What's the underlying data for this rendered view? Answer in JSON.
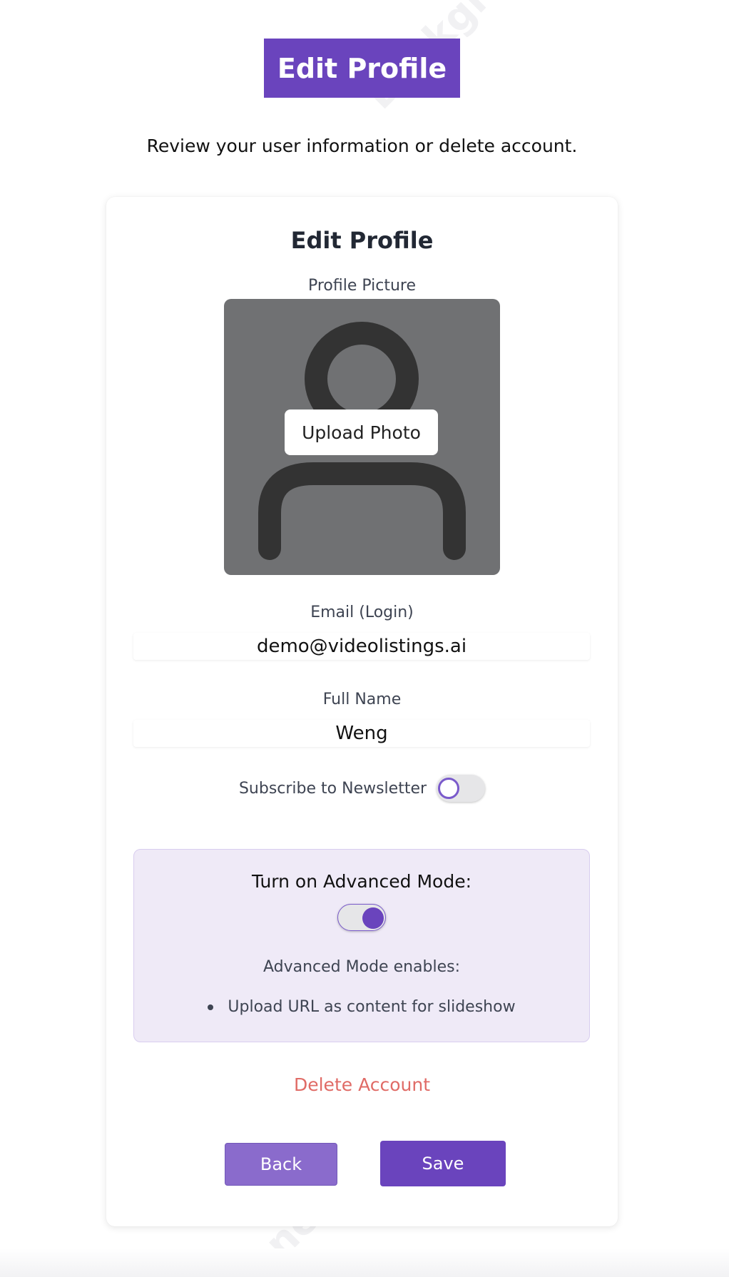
{
  "header": {
    "title": "Edit Profile",
    "subtitle": "Review your user information or delete account."
  },
  "card": {
    "title": "Edit Profile",
    "profile_picture_label": "Profile Picture",
    "upload_photo_label": "Upload Photo",
    "email_label": "Email (Login)",
    "email_value": "demo@videolistings.ai",
    "full_name_label": "Full Name",
    "full_name_value": "Weng",
    "newsletter_label": "Subscribe to Newsletter",
    "newsletter_enabled": false,
    "advanced": {
      "title": "Turn on Advanced Mode:",
      "enabled": true,
      "enables_label": "Advanced Mode enables:",
      "features": [
        "Upload URL as content for slideshow"
      ]
    },
    "delete_label": "Delete Account",
    "back_label": "Back",
    "save_label": "Save"
  },
  "watermark": {
    "text": "Background",
    "text_bottom": "Generated"
  },
  "colors": {
    "brand": "#6a44bd",
    "danger": "#e06b66",
    "advanced_bg": "#efeaf7"
  },
  "icons": {
    "avatar_placeholder": "user-silhouette-icon"
  }
}
